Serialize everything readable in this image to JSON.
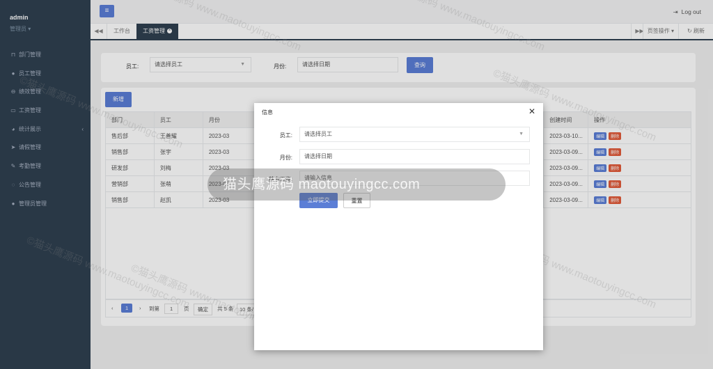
{
  "sidebar": {
    "user_name": "admin",
    "user_role": "管理员",
    "items": [
      {
        "label": "部门管理",
        "icon": "bookmark-icon"
      },
      {
        "label": "员工管理",
        "icon": "user-icon"
      },
      {
        "label": "绩效管理",
        "icon": "circle-icon"
      },
      {
        "label": "工资管理",
        "icon": "card-icon"
      },
      {
        "label": "统计展示",
        "icon": "pie-icon"
      },
      {
        "label": "请假管理",
        "icon": "send-icon"
      },
      {
        "label": "考勤管理",
        "icon": "edit-icon"
      },
      {
        "label": "公告管理",
        "icon": "comment-icon"
      },
      {
        "label": "管理员管理",
        "icon": "user-icon"
      }
    ]
  },
  "topbar": {
    "menu_icon": "≡",
    "logout": "Log out"
  },
  "tabs": {
    "t1": "工作台",
    "t2": "工资管理",
    "ops": "页签操作",
    "refresh": "刷新"
  },
  "search": {
    "employee_label": "员工:",
    "employee_placeholder": "请选择员工",
    "month_label": "月份:",
    "month_placeholder": "请选择日期",
    "query_button": "查询"
  },
  "table": {
    "add_button": "新增",
    "headers": [
      "部门",
      "员工",
      "月份",
      "创建时间",
      "操作"
    ],
    "rows": [
      {
        "dept": "售后部",
        "emp": "王善耀",
        "month": "2023-03",
        "created": "2023-03-10...",
        "edit": "编辑",
        "del": "删除"
      },
      {
        "dept": "销售部",
        "emp": "张宇",
        "month": "2023-03",
        "created": "2023-03-09...",
        "edit": "编辑",
        "del": "删除"
      },
      {
        "dept": "研发部",
        "emp": "刘梅",
        "month": "2023-03",
        "created": "2023-03-09...",
        "edit": "编辑",
        "del": "删除"
      },
      {
        "dept": "营销部",
        "emp": "张萌",
        "month": "2023-03",
        "created": "2023-03-09...",
        "edit": "编辑",
        "del": "删除"
      },
      {
        "dept": "销售部",
        "emp": "赵凯",
        "month": "2023-03",
        "created": "2023-03-09...",
        "edit": "编辑",
        "del": "删除"
      }
    ]
  },
  "pager": {
    "prev": "‹",
    "current": "1",
    "next": "›",
    "goto": "到第",
    "page_value": "1",
    "page_unit": "页",
    "confirm": "确定",
    "total": "共 5 条",
    "size": "10 条/"
  },
  "modal": {
    "title": "信息",
    "close": "✕",
    "employee_label": "员工:",
    "employee_placeholder": "请选择员工",
    "month_label": "月份:",
    "month_placeholder": "请选择日期",
    "salary_label": "基本工资:",
    "salary_placeholder": "请输入信息",
    "submit": "立即提交",
    "reset": "重置"
  },
  "banner": "猫头鹰源码 maotouyingcc.com",
  "watermark": "©猫头鹰源码 www.maotouyingcc.com"
}
